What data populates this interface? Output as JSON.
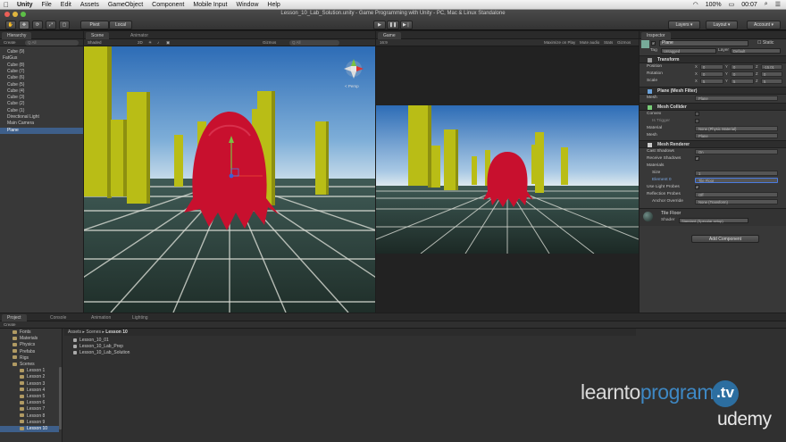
{
  "menubar": {
    "items": [
      "Unity",
      "File",
      "Edit",
      "Assets",
      "GameObject",
      "Component",
      "Mobile Input",
      "Window",
      "Help"
    ],
    "clock": "00:07",
    "battery": "100%"
  },
  "window": {
    "title": "Lesson_10_Lab_Solution.unity - Game Programming with Unity - PC, Mac & Linux Standalone"
  },
  "toolbar": {
    "pivot": "Pivot",
    "local": "Local",
    "layers": "Layers",
    "layout": "Layout",
    "account": "Account"
  },
  "hierarchy": {
    "tab": "Hierarchy",
    "create": "Create",
    "search_placeholder": "Q All",
    "items": [
      "Cube (9)",
      "FatGus",
      "Cube (8)",
      "Cube (7)",
      "Cube (6)",
      "Cube (5)",
      "Cube (4)",
      "Cube (3)",
      "Cube (2)",
      "Cube (1)",
      "Directional Light",
      "Main Camera",
      "Plane"
    ],
    "selected_index": 12
  },
  "scene": {
    "tab_scene": "Scene",
    "tab_animator": "Animator",
    "shaded": "Shaded",
    "mode": "2D",
    "gizmos": "Gizmos",
    "search": "Q All",
    "persp": "< Persp"
  },
  "game": {
    "tab": "Game",
    "aspect": "16:9",
    "maximize": "Maximize on Play",
    "mute": "Mute audio",
    "stats": "Stats",
    "gizmos": "Gizmos"
  },
  "inspector": {
    "tab": "Inspector",
    "object_name": "Plane",
    "static": "Static",
    "tag_label": "Tag",
    "tag_value": "Untagged",
    "layer_label": "Layer",
    "layer_value": "Default",
    "transform": {
      "title": "Transform",
      "position_label": "Position",
      "rotation_label": "Rotation",
      "scale_label": "Scale",
      "position": [
        "0",
        "0",
        "-15.01"
      ],
      "rotation": [
        "0",
        "0",
        "0"
      ],
      "scale": [
        "5",
        "5",
        "5"
      ]
    },
    "mesh_filter": {
      "title": "Plane (Mesh Filter)",
      "mesh_label": "Mesh",
      "mesh_value": "Plane"
    },
    "mesh_collider": {
      "title": "Mesh Collider",
      "convex": "Convex",
      "is_trigger": "Is Trigger",
      "material_label": "Material",
      "material_value": "None (Physic Material)",
      "mesh_label": "Mesh",
      "mesh_value": "Plane"
    },
    "mesh_renderer": {
      "title": "Mesh Renderer",
      "cast_shadows": "Cast Shadows",
      "cast_shadows_value": "On",
      "receive_shadows": "Receive Shadows",
      "materials": "Materials",
      "size_label": "Size",
      "size_value": "1",
      "element_label": "Element 0",
      "element_value": "Tile Floor",
      "light_probes": "Use Light Probes",
      "reflection_probes": "Reflection Probes",
      "reflection_value": "Off",
      "anchor": "Anchor Override",
      "anchor_value": "None (Transform)"
    },
    "material": {
      "name": "Tile Floor",
      "shader_label": "Shader",
      "shader_value": "Standard (Specular setup)"
    },
    "add_component": "Add Component"
  },
  "project": {
    "tabs": [
      "Project",
      "Console",
      "Animation",
      "Lighting"
    ],
    "create": "Create",
    "folders": [
      "Fonts",
      "Materials",
      "Physics",
      "Prefabs",
      "Rigs",
      "Scenes",
      "Lesson 1",
      "Lesson 2",
      "Lesson 3",
      "Lesson 4",
      "Lesson 5",
      "Lesson 6",
      "Lesson 7",
      "Lesson 8",
      "Lesson 9",
      "Lesson 10"
    ],
    "breadcrumb": [
      "Assets",
      "Scenes",
      "Lesson 10"
    ],
    "files": [
      "Lesson_10_01",
      "Lesson_10_Lab_Prep",
      "Lesson_10_Lab_Solution"
    ]
  },
  "brand": {
    "learnto": "learnto",
    "program": "program",
    "tv": ".tv",
    "udemy": "udemy"
  },
  "colors": {
    "accent": "#3e5f8a",
    "ghost": "#c8102e",
    "pillar": "#b9bd16",
    "sky_top": "#2e6fb8",
    "floor": "#2c3e38"
  }
}
